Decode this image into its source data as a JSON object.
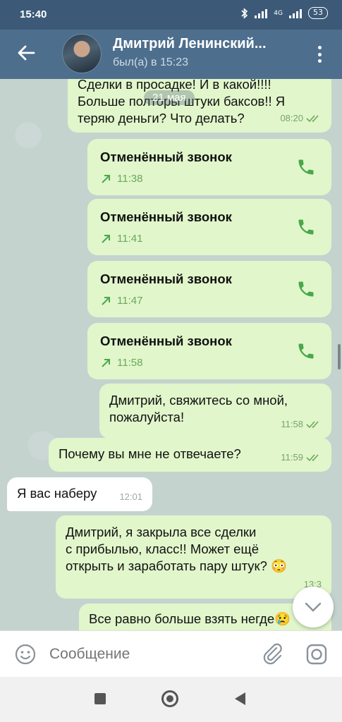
{
  "status_bar": {
    "time": "15:40",
    "network": "4G",
    "battery": "53"
  },
  "header": {
    "name": "Дмитрий Ленинский...",
    "status": "был(а) в 15:23"
  },
  "chat": {
    "date_badge": "21 мая",
    "top_message": {
      "lines": [
        "Сделки в просадке! И в какой!!!!",
        "Больше полторы штуки баксов!! Я",
        "теряю деньги? Что делать?"
      ],
      "time": "08:20"
    },
    "calls": [
      {
        "label": "Отменённый звонок",
        "time": "11:38"
      },
      {
        "label": "Отменённый звонок",
        "time": "11:41"
      },
      {
        "label": "Отменённый звонок",
        "time": "11:47"
      },
      {
        "label": "Отменённый звонок",
        "time": "11:58"
      }
    ],
    "messages": [
      {
        "lines": [
          "Дмитрий, свяжитесь со мной,",
          "пожалуйста!"
        ],
        "time": "11:58"
      },
      {
        "lines": [
          "Почему вы мне не отвечаете?"
        ],
        "time": "11:59"
      },
      {
        "lines": [
          "Я вас наберу"
        ],
        "time": "12:01"
      },
      {
        "lines": [
          "Дмитрий, я закрыла все сделки",
          "с прибылью, класс!! Может ещё",
          "открыть и заработать пару штук? 😳"
        ],
        "time": "13:3"
      },
      {
        "lines": [
          "Все равно больше взять негде😢"
        ]
      }
    ]
  },
  "input": {
    "placeholder": "Сообщение"
  },
  "colors": {
    "header": "#4d6e8d",
    "outgoing_bubble": "#e1f6cb",
    "incoming_bubble": "#ffffff",
    "call_green": "#4aa84a"
  }
}
